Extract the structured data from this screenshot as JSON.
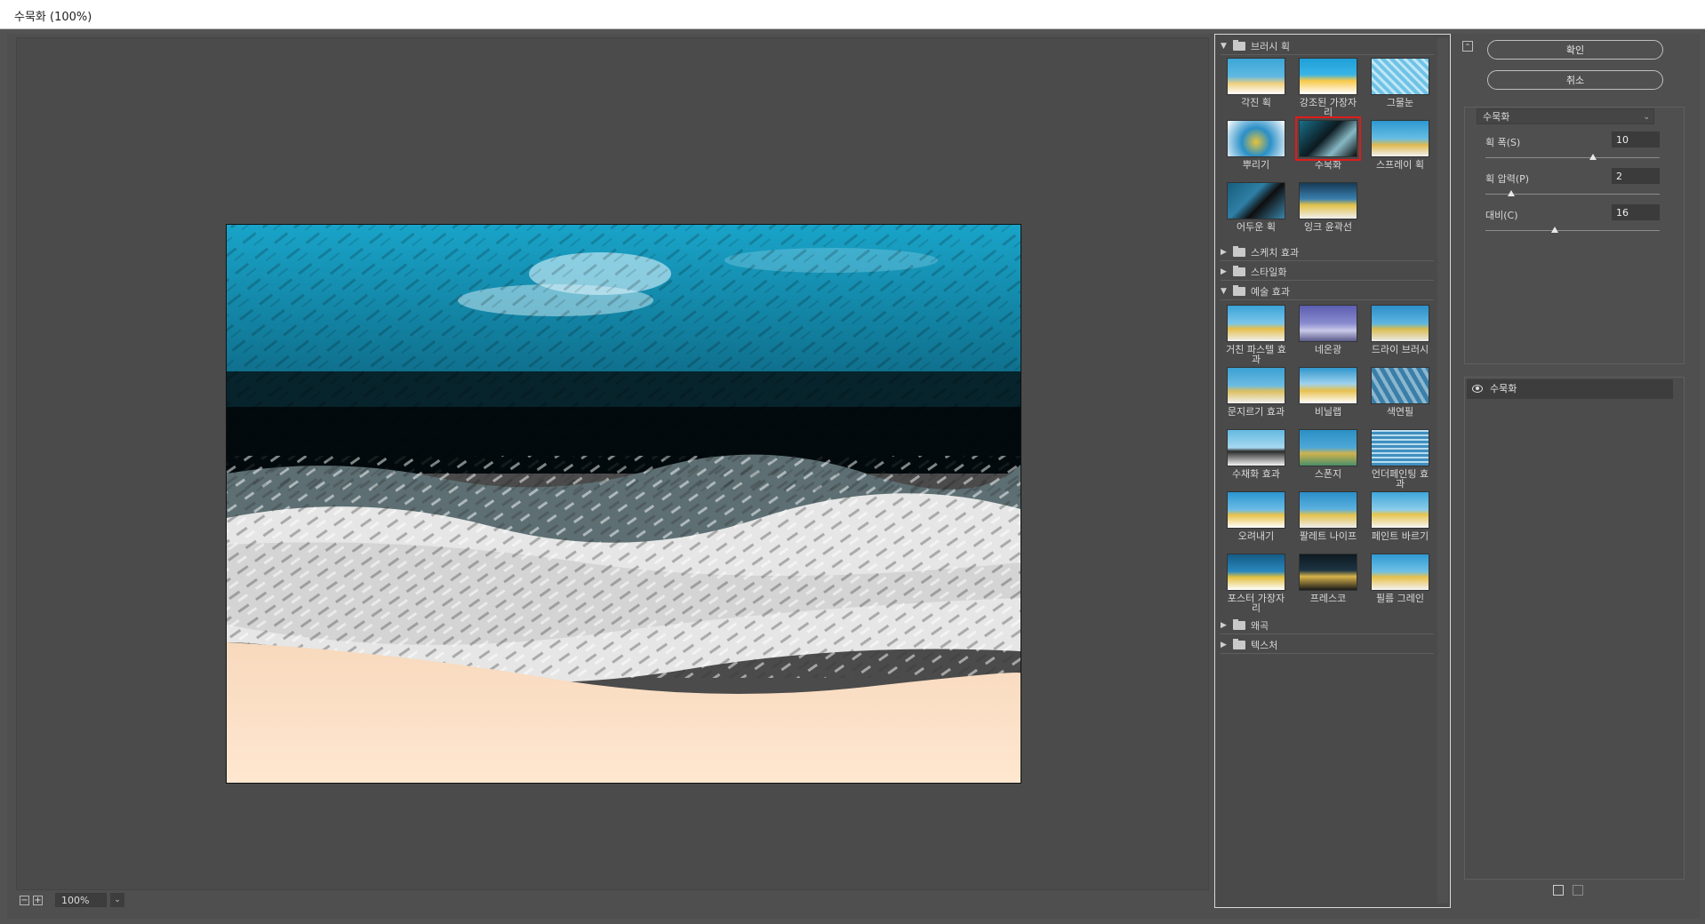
{
  "window": {
    "title": "수묵화 (100%)"
  },
  "preview": {
    "zoom": "100%"
  },
  "gallery": {
    "categories": [
      {
        "name": "브러시 획",
        "expanded": true,
        "filters": [
          "각진 획",
          "강조된 가장자리",
          "그물눈",
          "뿌리기",
          "수묵화",
          "스프레이 획",
          "어두운 획",
          "잉크 윤곽선"
        ]
      },
      {
        "name": "스케치 효과",
        "expanded": false
      },
      {
        "name": "스타일화",
        "expanded": false
      },
      {
        "name": "예술 효과",
        "expanded": true,
        "filters": [
          "거친 파스텔 효과",
          "네온광",
          "드라이 브러시",
          "문지르기 효과",
          "비닐랩",
          "색연필",
          "수채화 효과",
          "스폰지",
          "언더페인팅 효과",
          "오려내기",
          "팔레트 나이프",
          "페인트 바르기",
          "포스터 가장자리",
          "프레스코",
          "필름 그레인"
        ]
      },
      {
        "name": "왜곡",
        "expanded": false
      },
      {
        "name": "텍스처",
        "expanded": false
      }
    ],
    "selected": "수묵화",
    "selected_color": "#e01b1b"
  },
  "buttons": {
    "ok": "확인",
    "cancel": "취소"
  },
  "settings": {
    "filter_select": "수묵화",
    "params": [
      {
        "label": "획 폭(S)",
        "value": "10",
        "fraction": 0.6
      },
      {
        "label": "획 압력(P)",
        "value": "2",
        "fraction": 0.14
      },
      {
        "label": "대비(C)",
        "value": "16",
        "fraction": 0.4
      }
    ]
  },
  "layers": {
    "items": [
      "수묵화"
    ]
  },
  "icons": {
    "collapse": "collapse-icon",
    "new_layer": "new-effect-layer-icon",
    "delete": "trash-icon",
    "eye": "eye-icon"
  }
}
